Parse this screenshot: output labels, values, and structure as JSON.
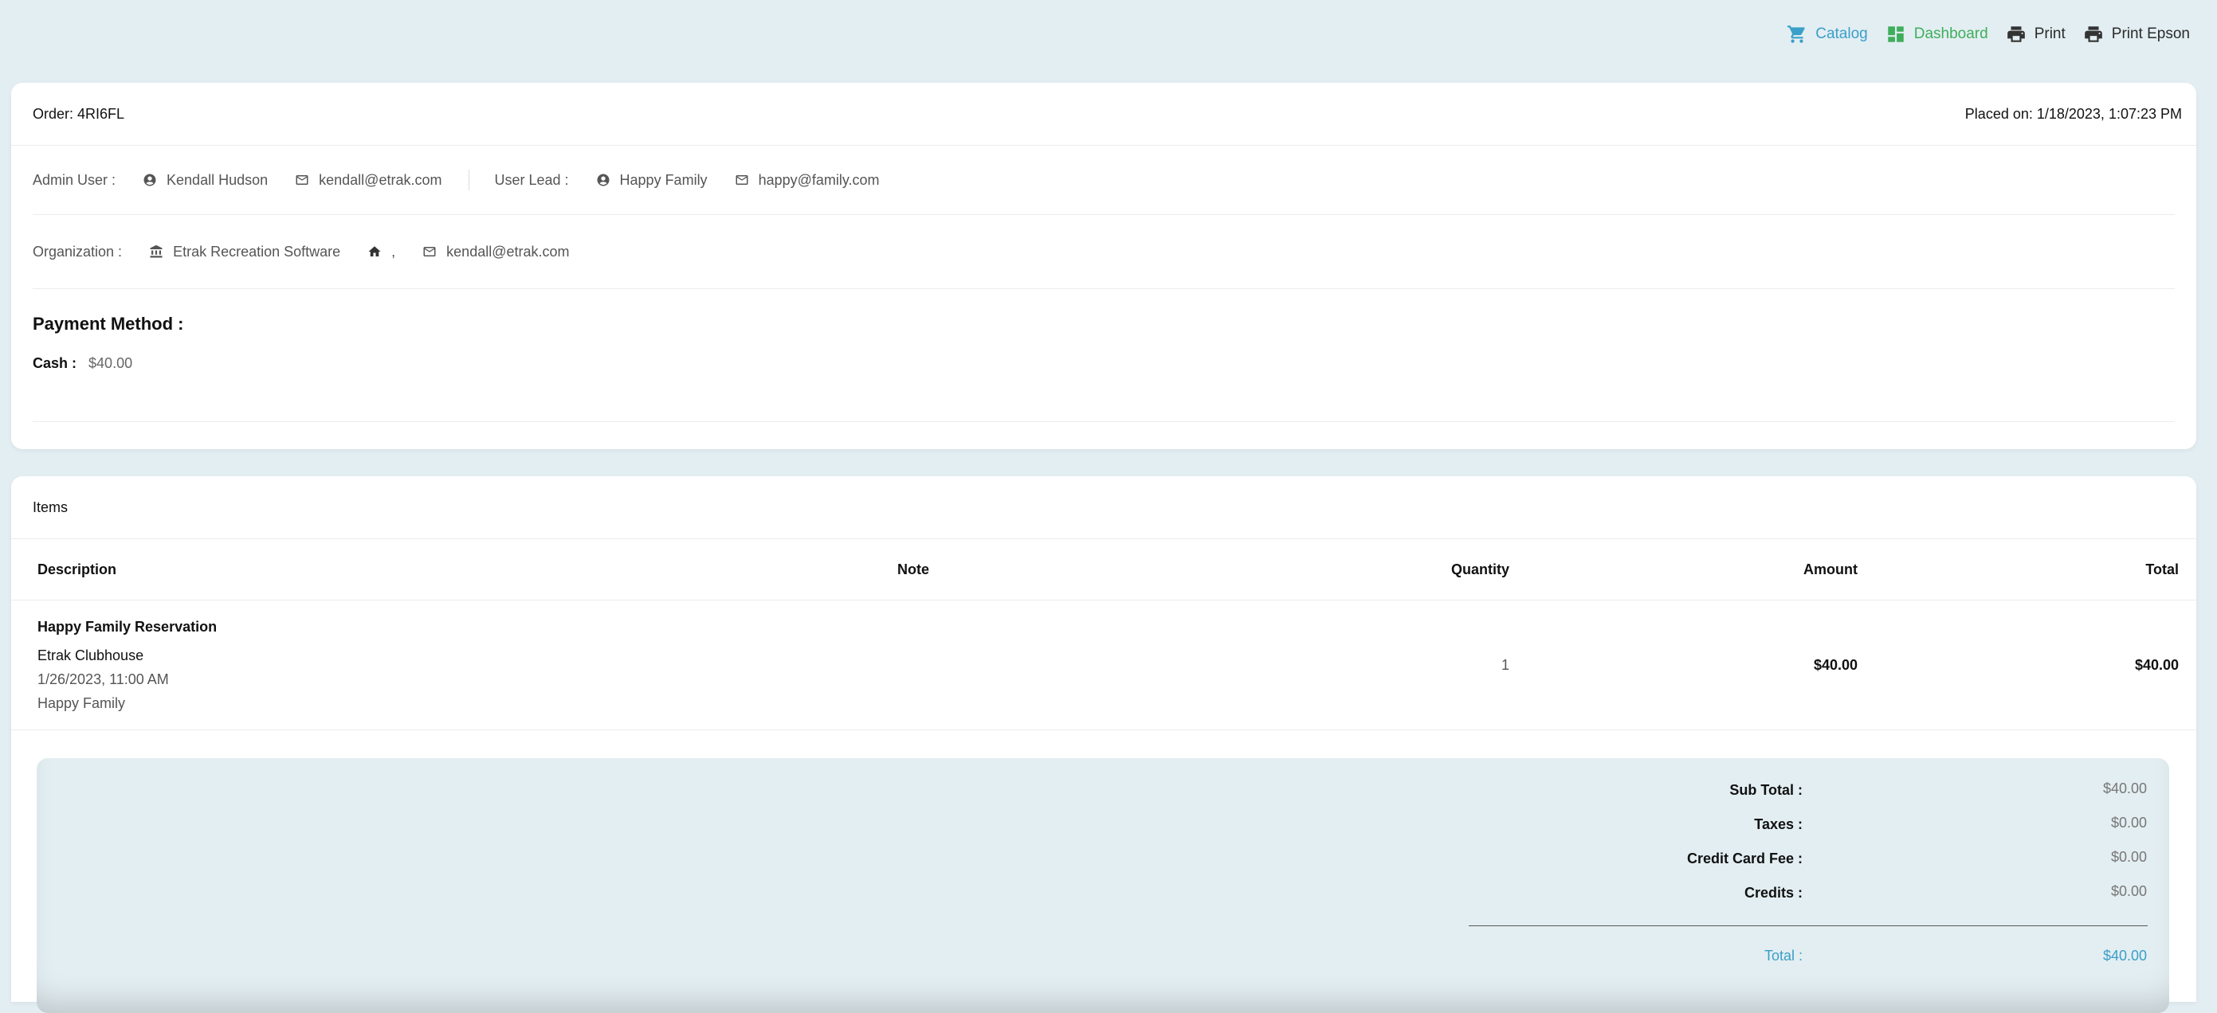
{
  "toolbar": {
    "catalog": "Catalog",
    "dashboard": "Dashboard",
    "print": "Print",
    "print_epson": "Print Epson"
  },
  "order": {
    "id_label": "Order: 4RI6FL",
    "placed_on": "Placed on: 1/18/2023, 1:07:23 PM",
    "admin_user_label": "Admin User :",
    "admin_user_name": "Kendall Hudson",
    "admin_user_email": "kendall@etrak.com",
    "user_lead_label": "User Lead :",
    "user_lead_name": "Happy Family",
    "user_lead_email": "happy@family.com",
    "organization_label": "Organization :",
    "organization_name": "Etrak Recreation Software",
    "organization_address": ",",
    "organization_email": "kendall@etrak.com",
    "payment_method_title": "Payment Method :",
    "payment_type": "Cash :",
    "payment_amount": "$40.00"
  },
  "items": {
    "title": "Items",
    "columns": {
      "description": "Description",
      "note": "Note",
      "quantity": "Quantity",
      "amount": "Amount",
      "total": "Total"
    },
    "rows": [
      {
        "title": "Happy Family Reservation",
        "location": "Etrak Clubhouse",
        "datetime": "1/26/2023, 11:00 AM",
        "customer": "Happy Family",
        "note": "",
        "quantity": "1",
        "amount": "$40.00",
        "total": "$40.00"
      }
    ]
  },
  "summary": {
    "subtotal_label": "Sub Total :",
    "subtotal": "$40.00",
    "taxes_label": "Taxes :",
    "taxes": "$0.00",
    "cc_fee_label": "Credit Card Fee :",
    "cc_fee": "$0.00",
    "credits_label": "Credits :",
    "credits": "$0.00",
    "total_label": "Total :",
    "total": "$40.00"
  },
  "colors": {
    "background": "#e3eef2",
    "accent_blue": "#3a9fc9",
    "accent_green": "#3fae5c"
  }
}
